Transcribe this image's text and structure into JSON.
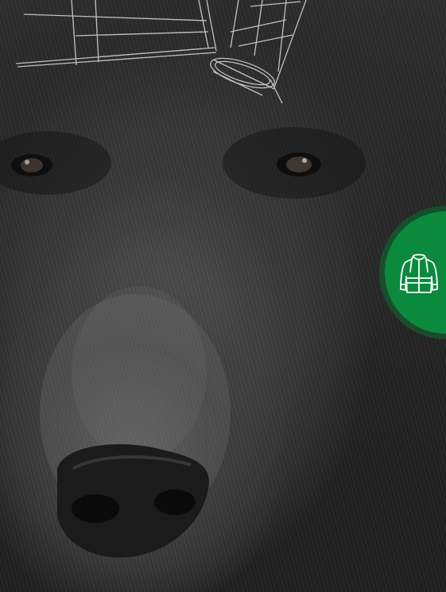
{
  "scene": {
    "subject": "bear-face",
    "style": "grayscale-photo-with-sketch-overlay"
  },
  "badge": {
    "color": "#0b8a3e",
    "icon": "hi-vis-jacket-icon"
  }
}
